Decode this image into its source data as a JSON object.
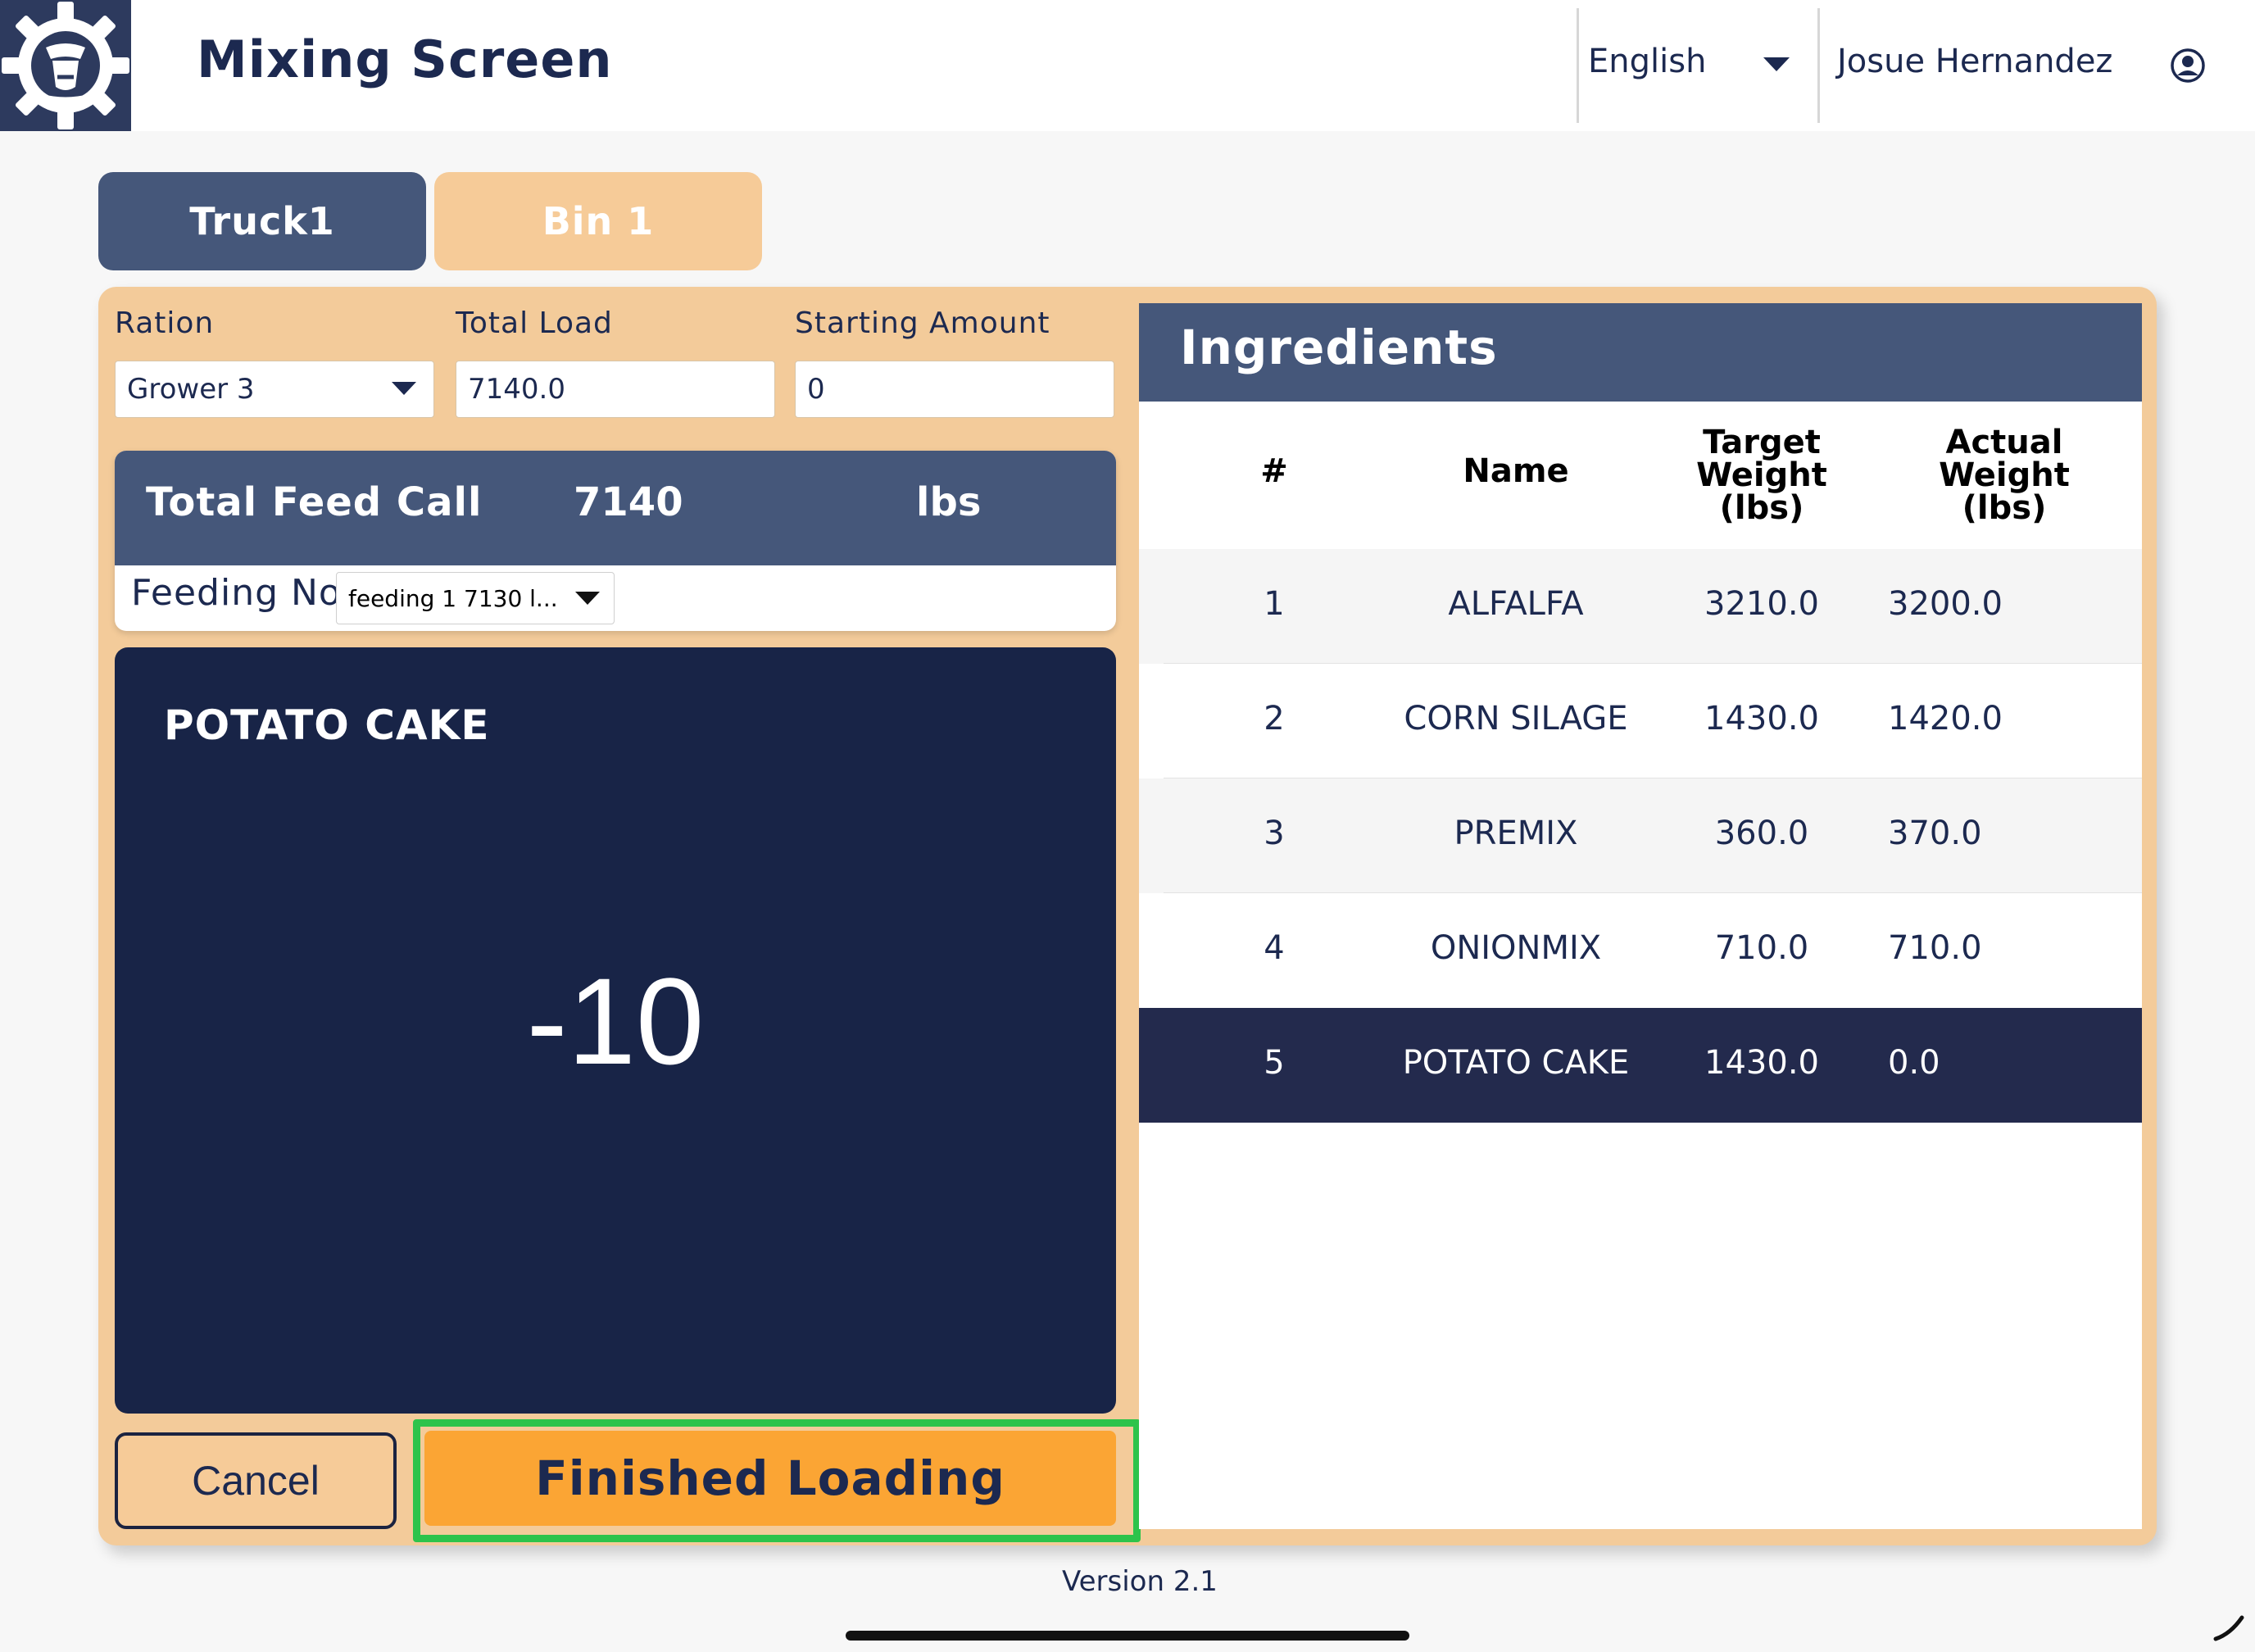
{
  "header": {
    "title": "Mixing Screen",
    "language": "English",
    "user_name": "Josue Hernandez",
    "icons": {
      "logo": "cow-gear-logo",
      "user": "user-circle-icon",
      "dropdown": "chevron-down-icon"
    }
  },
  "tabs": [
    {
      "label": "Truck1",
      "selected": true
    },
    {
      "label": "Bin 1",
      "selected": false
    }
  ],
  "form": {
    "ration_label": "Ration",
    "ration_value": "Grower 3",
    "total_load_label": "Total Load",
    "total_load_value": "7140.0",
    "starting_amount_label": "Starting Amount",
    "starting_amount_value": "0"
  },
  "feed_call": {
    "label": "Total Feed Call",
    "value": "7140",
    "unit": "lbs",
    "feeding_label": "Feeding No.",
    "feeding_value": "feeding 1   7130 l..."
  },
  "display": {
    "ingredient": "POTATO CAKE",
    "value": "-10"
  },
  "buttons": {
    "cancel": "Cancel",
    "finish": "Finished Loading"
  },
  "ingredients": {
    "title": "Ingredients",
    "headers": {
      "num": "#",
      "name": "Name",
      "target_1": "Target Weight",
      "target_2": "(lbs)",
      "actual_1": "Actual Weight",
      "actual_2": "(lbs)"
    },
    "rows": [
      {
        "num": "1",
        "name": "ALFALFA",
        "target": "3210.0",
        "actual": "3200.0"
      },
      {
        "num": "2",
        "name": "CORN SILAGE",
        "target": "1430.0",
        "actual": "1420.0"
      },
      {
        "num": "3",
        "name": "PREMIX",
        "target": "360.0",
        "actual": "370.0"
      },
      {
        "num": "4",
        "name": "ONIONMIX",
        "target": "710.0",
        "actual": "710.0"
      },
      {
        "num": "5",
        "name": "POTATO CAKE",
        "target": "1430.0",
        "actual": "0.0"
      }
    ],
    "active_row": 5
  },
  "footer": {
    "version": "Version 2.1"
  },
  "colors": {
    "navy": "#182447",
    "slate": "#45577a",
    "tan": "#f3cb9a",
    "orange": "#fba534",
    "highlight_green": "#2dc34b"
  }
}
